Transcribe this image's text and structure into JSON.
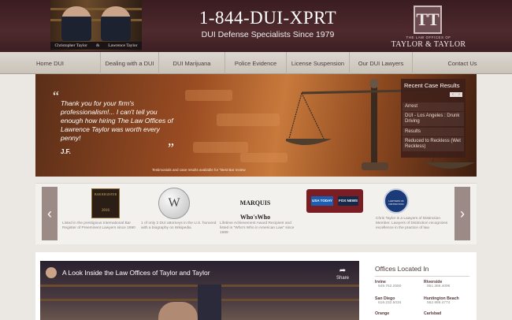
{
  "header": {
    "photo_names": [
      "Christopher Taylor",
      "&",
      "Lawrence Taylor"
    ],
    "phone": "1-844-DUI-XPRT",
    "tagline": "DUI Defense Specialists Since 1979",
    "logo_mark": "TT",
    "logo_sub": "THE LAW OFFICES OF",
    "logo_name": "TAYLOR & TAYLOR"
  },
  "nav": [
    "Home DUI",
    "Dealing with a DUI",
    "DUI Marijuana",
    "Police Evidence",
    "License Suspension",
    "Our DUI Lawyers",
    "Contact Us"
  ],
  "hero": {
    "quote_open": "“",
    "quote": "Thank you for your firm's professionalism!... I can't tell you enough how hiring The Law Offices of Lawrence Taylor was worth every penny!",
    "quote_close": "”",
    "author": "J.F.",
    "note": "Testimonials and case results available for \"Best Bar review",
    "recent_title": "Recent Case Results",
    "recent_nav": [
      "‹",
      "›"
    ],
    "recent_items": [
      "Arrest",
      "DUI - Los Angeles : Drunk Driving",
      "Results",
      "Reduced to Reckless (Wet Reckless)"
    ]
  },
  "awards": {
    "prev": "‹",
    "next": "›",
    "items": [
      {
        "badge": "BAR REGISTER",
        "badge_sub": "2016",
        "caption": "Listed in the prestigious International Bar Register of Preeminent Lawyers since 1990"
      },
      {
        "badge": "W",
        "caption": "1 of only 2 DUI attorneys in the U.S. honored with a biography on Wikipedia"
      },
      {
        "badge": "MARQUIS Who'sWho",
        "caption": "Lifetime Achievement Award Recipient and listed in \"Who's Who in American Law\" since 1989"
      },
      {
        "badge": "USA TODAY",
        "badge_b": "FOX NEWS",
        "caption": ""
      },
      {
        "badge": "LAWYERS OF DISTINCTION",
        "caption": "Chris Taylor is a Lawyers of Distinction Member. Lawyers of Distinction recognizes excellence in the practice of law."
      }
    ]
  },
  "video": {
    "title": "A Look Inside the Law Offices of Taylor and Taylor",
    "share": "Share"
  },
  "offices": {
    "title": "Offices Located In",
    "locations": [
      {
        "city": "Irvine",
        "phone": "949.752.2550"
      },
      {
        "city": "Riverside",
        "phone": "951.369.4096"
      },
      {
        "city": "San Diego",
        "phone": "619.232.5034"
      },
      {
        "city": "Huntington Beach",
        "phone": "562.989.4774"
      },
      {
        "city": "Orange",
        "phone": ""
      },
      {
        "city": "Carlsbad",
        "phone": ""
      }
    ]
  },
  "colors": {
    "header_bg": "#4e2a2e",
    "nav_bg": "#d4cec5",
    "accent": "#5a3a3c"
  }
}
